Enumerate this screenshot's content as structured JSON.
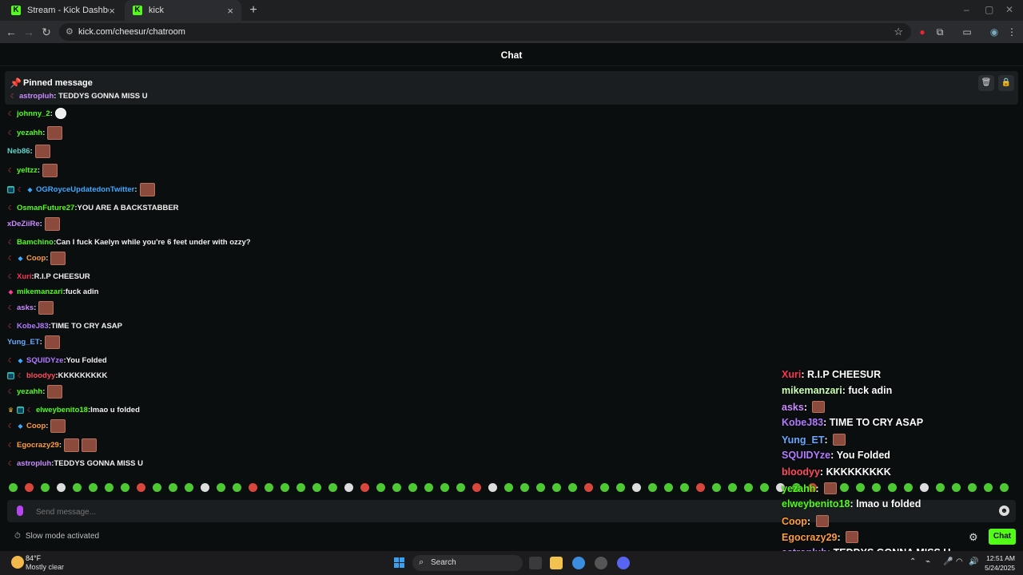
{
  "browser": {
    "tabs": [
      {
        "title": "Stream - Kick Dashboard",
        "active": false
      },
      {
        "title": "kick",
        "active": true
      }
    ],
    "new_tab": "+",
    "url": "kick.com/cheesur/chatroom"
  },
  "chat": {
    "header": "Chat",
    "pinned": {
      "title": "Pinned message",
      "user": "astropluh",
      "user_color": "#c98bff",
      "text": "TEDDYS GONNA MISS U"
    },
    "messages": [
      {
        "user": "johnny_2",
        "color": "#53fc18",
        "text": "",
        "emotes": "round",
        "badges": [
          "sub"
        ]
      },
      {
        "user": "yezahh",
        "color": "#53fc18",
        "text": "",
        "emotes": 1,
        "badges": [
          "sub"
        ]
      },
      {
        "user": "Neb86",
        "color": "#5fd3c7",
        "text": "",
        "emotes": 1,
        "badges": []
      },
      {
        "user": "yeltzz",
        "color": "#53fc18",
        "text": "",
        "emotes": 1,
        "badges": [
          "sub"
        ]
      },
      {
        "user": "OGRoyceUpdatedonTwitter",
        "color": "#3fa9ff",
        "text": "",
        "emotes": 1,
        "badges": [
          "og",
          "sub",
          "gift"
        ]
      },
      {
        "user": "OsmanFuture27",
        "color": "#53fc18",
        "text": "YOU ARE A BACKSTABBER",
        "emotes": 0,
        "badges": [
          "sub"
        ]
      },
      {
        "user": "xDeZiiRe",
        "color": "#c98bff",
        "text": "",
        "emotes": 1,
        "badges": []
      },
      {
        "user": "Bamchino",
        "color": "#53fc18",
        "text": "Can I fuck Kaelyn while you're 6 feet under with ozzy?",
        "emotes": 0,
        "badges": [
          "sub"
        ]
      },
      {
        "user": "Coop",
        "color": "#ff9d3a",
        "text": "",
        "emotes": 1,
        "badges": [
          "sub",
          "gift"
        ]
      },
      {
        "user": "Xuri",
        "color": "#ff3355",
        "text": "R.I.P CHEESUR",
        "emotes": 0,
        "badges": [
          "sub"
        ]
      },
      {
        "user": "mikemanzari",
        "color": "#53fc18",
        "text": "fuck adin",
        "emotes": 0,
        "badges": [
          "gift2"
        ]
      },
      {
        "user": "asks",
        "color": "#c98bff",
        "text": "",
        "emotes": 1,
        "badges": [
          "sub"
        ]
      },
      {
        "user": "KobeJ83",
        "color": "#b17bff",
        "text": "TIME TO CRY ASAP",
        "emotes": 0,
        "badges": [
          "sub"
        ]
      },
      {
        "user": "Yung_ET",
        "color": "#6aa8ff",
        "text": "",
        "emotes": 1,
        "badges": []
      },
      {
        "user": "SQUIDYze",
        "color": "#b17bff",
        "text": "You Folded",
        "emotes": 0,
        "badges": [
          "sub",
          "gift"
        ]
      },
      {
        "user": "bloodyy",
        "color": "#ff4b5c",
        "text": "KKKKKKKKK",
        "emotes": 0,
        "badges": [
          "og",
          "sub"
        ]
      },
      {
        "user": "yezahh",
        "color": "#53fc18",
        "text": "",
        "emotes": 1,
        "badges": [
          "sub"
        ]
      },
      {
        "user": "elweybenito18",
        "color": "#53fc18",
        "text": "lmao u folded",
        "emotes": 0,
        "badges": [
          "crown",
          "og",
          "sub"
        ]
      },
      {
        "user": "Coop",
        "color": "#ff9d3a",
        "text": "",
        "emotes": 1,
        "badges": [
          "sub",
          "gift"
        ]
      },
      {
        "user": "Egocrazy29",
        "color": "#ff9d3a",
        "text": "",
        "emotes": 2,
        "badges": [
          "sub"
        ]
      },
      {
        "user": "astropluh",
        "color": "#c98bff",
        "text": "TEDDYS GONNA MISS U",
        "emotes": 0,
        "badges": [
          "sub"
        ]
      }
    ],
    "input_placeholder": "Send message...",
    "slow_mode": "Slow mode activated",
    "send_label": "Chat"
  },
  "overlay": [
    {
      "user": "Xuri",
      "color": "#ff3355",
      "text": "R.I.P CHEESUR",
      "emotes": 0
    },
    {
      "user": "mikemanzari",
      "color": "#c9ffb0",
      "text": "fuck adin",
      "emotes": 0
    },
    {
      "user": "asks",
      "color": "#c98bff",
      "text": "",
      "emotes": 1
    },
    {
      "user": "KobeJ83",
      "color": "#b17bff",
      "text": "TIME TO CRY ASAP",
      "emotes": 0
    },
    {
      "user": "Yung_ET",
      "color": "#6aa8ff",
      "text": "",
      "emotes": 1
    },
    {
      "user": "SQUIDYze",
      "color": "#b17bff",
      "text": "You Folded",
      "emotes": 0
    },
    {
      "user": "bloodyy",
      "color": "#ff4b5c",
      "text": "KKKKKKKKK",
      "emotes": 0
    },
    {
      "user": "yezahh",
      "color": "#53fc18",
      "text": "",
      "emotes": 1
    },
    {
      "user": "elweybenito18",
      "color": "#53fc18",
      "text": "lmao u folded",
      "emotes": 0
    },
    {
      "user": "Coop",
      "color": "#ff9d3a",
      "text": "",
      "emotes": 1
    },
    {
      "user": "Egocrazy29",
      "color": "#ff9d3a",
      "text": "",
      "emotes": 1
    },
    {
      "user": "astropluh",
      "color": "#c98bff",
      "text": "TEDDYS GONNA MISS U",
      "emotes": 0
    }
  ],
  "taskbar": {
    "weather_temp": "84°F",
    "weather_desc": "Mostly clear",
    "search_label": "Search",
    "time": "12:51 AM",
    "date": "5/24/2025"
  }
}
